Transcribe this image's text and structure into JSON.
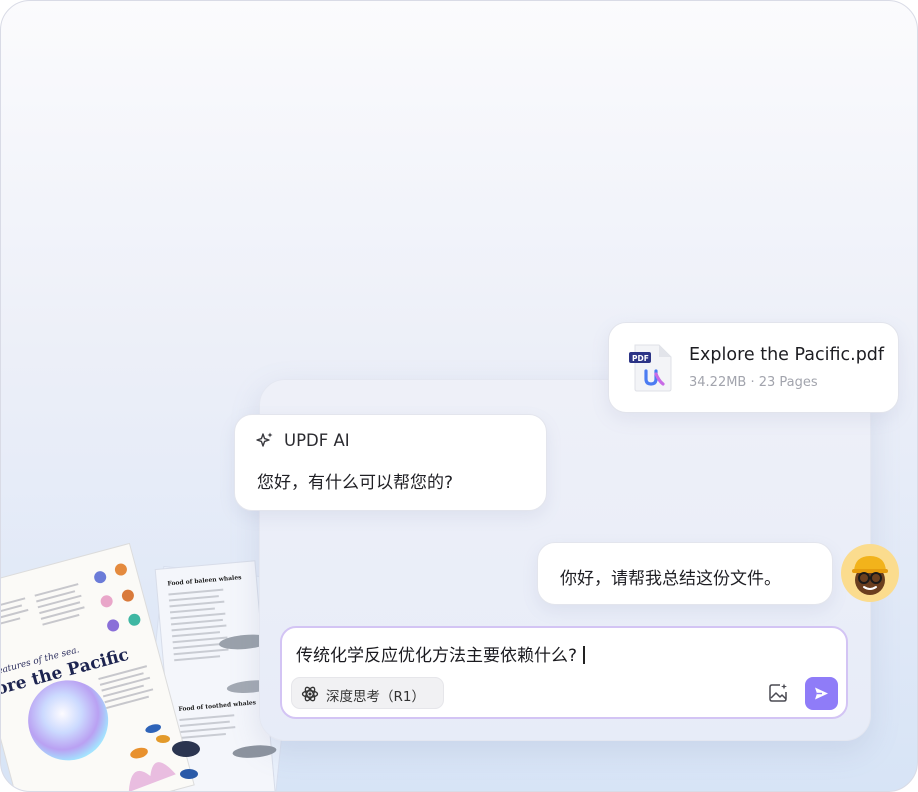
{
  "file": {
    "badge": "PDF",
    "name": "Explore the Pacific.pdf",
    "meta": "34.22MB · 23 Pages"
  },
  "ai": {
    "name": "UPDF AI",
    "greeting": "您好，有什么可以帮您的?"
  },
  "user": {
    "message": "你好，请帮我总结这份文件。"
  },
  "input": {
    "value": "传统化学反应优化方法主要依赖什么?",
    "think_label": "深度思考（R1）"
  },
  "doc_preview": {
    "subtitle": "creatures of the sea.",
    "title": "lore the Pacific",
    "section_a": "Food of baleen whales",
    "section_b": "Food of toothed whales"
  },
  "colors": {
    "accent": "#8f7cf8",
    "input_border": "#d3c4f4",
    "avatar_bg": "#fbdc8e"
  }
}
